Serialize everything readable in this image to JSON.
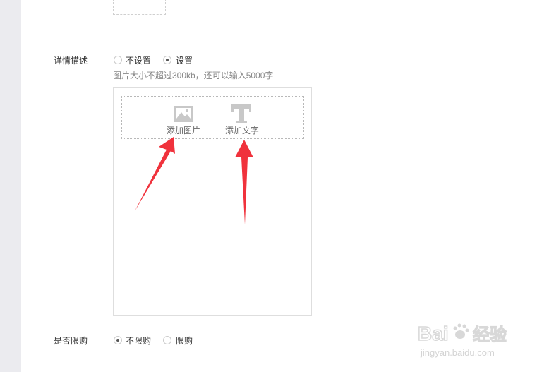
{
  "detail": {
    "label": "详情描述",
    "options": [
      "不设置",
      "设置"
    ],
    "selected": "设置",
    "hint": "图片大小不超过300kb，还可以输入5000字"
  },
  "editor": {
    "add_image_label": "添加图片",
    "add_text_label": "添加文字"
  },
  "purchase_limit": {
    "label": "是否限购",
    "options": [
      "不限购",
      "限购"
    ],
    "selected": "不限购"
  },
  "watermark": {
    "brand_text": "Bai经验",
    "url": "jingyan.baidu.com"
  },
  "colors": {
    "arrow": "#f0323c",
    "sidebar": "#ebebef",
    "icon": "#c8c8c8"
  },
  "icons": [
    "image-icon",
    "text-t-icon",
    "red-arrow-annotation",
    "baidu-paw-logo"
  ]
}
